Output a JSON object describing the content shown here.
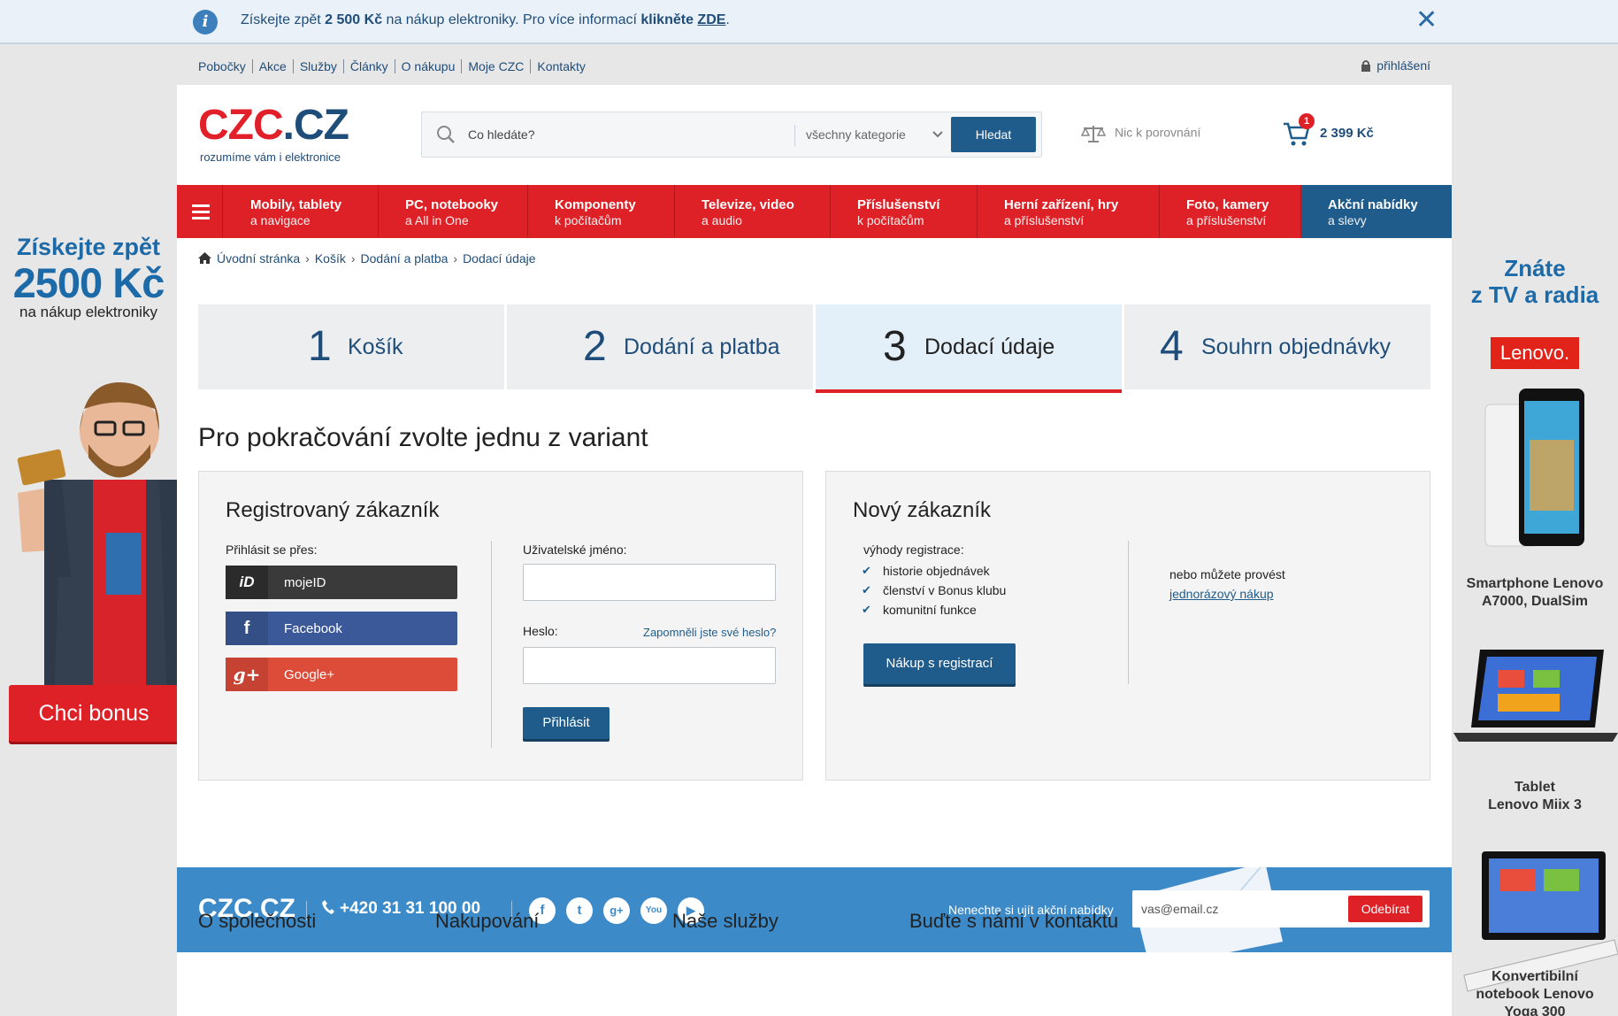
{
  "infobar": {
    "msg_pre": "Získejte zpět ",
    "msg_amount": "2 500 Kč",
    "msg_mid": " na nákup elektroniky. Pro více informací ",
    "msg_click": "klikněte",
    "msg_link": "ZDE",
    "msg_end": ".",
    "close": "✕"
  },
  "ad_left": {
    "line1": "Získejte zpět",
    "line2": "2500 Kč",
    "line3": "na nákup elektroniky",
    "button": "Chci bonus"
  },
  "ad_right": {
    "line1": "Znáte",
    "line2": "z TV a radia",
    "brand": "Lenovo.",
    "products": [
      {
        "line1": "Smartphone Lenovo",
        "line2": "A7000, DualSim"
      },
      {
        "line1": "Tablet",
        "line2": "Lenovo Miix 3"
      },
      {
        "line1": "Konvertibilní",
        "line2": "notebook Lenovo",
        "line3": "Yoga 300"
      }
    ]
  },
  "topnav": {
    "links": [
      "Pobočky",
      "Akce",
      "Služby",
      "Články",
      "O nákupu",
      "Moje CZC",
      "Kontakty"
    ],
    "login": "přihlášení"
  },
  "header": {
    "logo_red": "CZC",
    "logo_blue": ".CZ",
    "tagline": "rozumíme vám i elektronice",
    "search_placeholder": "Co hledáte?",
    "search_category": "všechny kategorie",
    "search_button": "Hledat",
    "compare": "Nic k porovnání",
    "cart_count": "1",
    "cart_amount": "2 399 Kč"
  },
  "categories": [
    {
      "title": "Mobily, tablety",
      "sub": "a navigace"
    },
    {
      "title": "PC, notebooky",
      "sub": "a All in One"
    },
    {
      "title": "Komponenty",
      "sub": "k počítačům"
    },
    {
      "title": "Televize, video",
      "sub": "a audio"
    },
    {
      "title": "Příslušenství",
      "sub": "k počítačům"
    },
    {
      "title": "Herní zařízení, hry",
      "sub": "a příslušenství"
    },
    {
      "title": "Foto, kamery",
      "sub": "a příslušenství"
    },
    {
      "title": "Akční nabídky",
      "sub": "a slevy"
    }
  ],
  "breadcrumb": [
    "Úvodní stránka",
    "Košík",
    "Dodání a platba",
    "Dodací údaje"
  ],
  "steps": [
    {
      "num": "1",
      "label": "Košík"
    },
    {
      "num": "2",
      "label": "Dodání a platba"
    },
    {
      "num": "3",
      "label": "Dodací údaje"
    },
    {
      "num": "4",
      "label": "Souhrn objednávky"
    }
  ],
  "active_step": 3,
  "heading": "Pro pokračování zvolte jednu z variant",
  "registered": {
    "title": "Registrovaný zákazník",
    "login_via": "Přihlásit se přes:",
    "social": [
      {
        "label": "mojeID",
        "icon": "iD",
        "color": "#3a3a3a"
      },
      {
        "label": "Facebook",
        "icon": "f",
        "color": "#3b5998"
      },
      {
        "label": "Google+",
        "icon": "g+",
        "color": "#dd4b39"
      }
    ],
    "username_label": "Uživatelské jméno:",
    "password_label": "Heslo:",
    "forgot": "Zapomněli jste své heslo?",
    "login_button": "Přihlásit"
  },
  "new_customer": {
    "title": "Nový zákazník",
    "benefits_title": "výhody registrace:",
    "benefits": [
      "historie objednávek",
      "členství v Bonus klubu",
      "komunitní funkce"
    ],
    "register_button": "Nákup s registrací",
    "or_text": "nebo můžete provést",
    "one_time_link": "jednorázový nákup"
  },
  "footer": {
    "logo": "CZC.CZ",
    "phone": "+420 31 31 100 00",
    "social_icons": [
      "facebook-icon",
      "twitter-icon",
      "google-plus-icon",
      "youtube-icon",
      "play-icon"
    ],
    "newsletter_text": "Nenechte si ujít akční nabídky",
    "email_placeholder": "vas@email.cz",
    "subscribe": "Odebírat",
    "columns": [
      "O společnosti",
      "Nakupování",
      "Naše služby",
      "Buďte s námi v kontaktu"
    ]
  },
  "colors": {
    "brand_red": "#dd2127",
    "brand_blue": "#1f5c8b",
    "footer_blue": "#3d8ac9"
  }
}
